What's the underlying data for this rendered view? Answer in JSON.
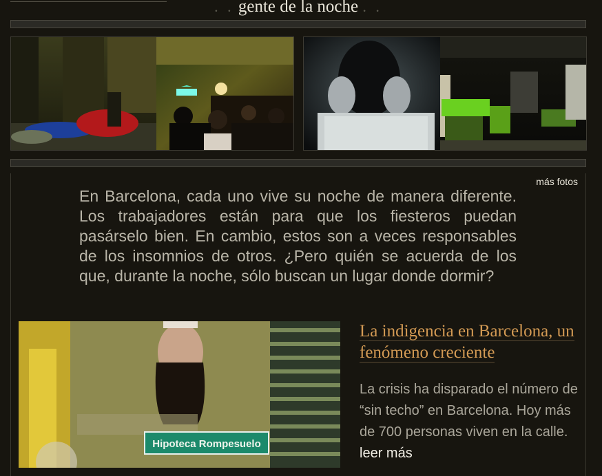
{
  "header": {
    "title": "gente de la noche",
    "dots_left": ". .",
    "dots_right": ". ."
  },
  "gallery": {
    "images": [
      {
        "icon": "street-sleeper-photo"
      },
      {
        "icon": "bar-crowd-photo"
      },
      {
        "icon": "covering-ears-photo"
      },
      {
        "icon": "empty-market-photo"
      }
    ],
    "more_photos_label": "más fotos"
  },
  "intro_text": "En Barcelona, cada uno vive su noche de manera diferente. Los trabajadores están para que los fiesteros puedan pasárselo bien. En cambio, estos son a veces responsables de los insomnios de otros. ¿Pero quién se acuerda de los que, durante la noche, sólo buscan un lugar donde dormir?",
  "article": {
    "headline": "La indigencia en Barcelona, un fenómeno creciente",
    "summary": "La crisis ha disparado el número de “sin techo” en Barcelona. Hoy más de 700 personas viven en la calle.",
    "read_more_label": "leer más",
    "image_sign_text": "Hipoteca Rompesuelo"
  },
  "colors": {
    "background": "#17150f",
    "headline": "#d39a54",
    "body_text": "#b9b5a8",
    "sign_green": "#1c8a6b"
  }
}
